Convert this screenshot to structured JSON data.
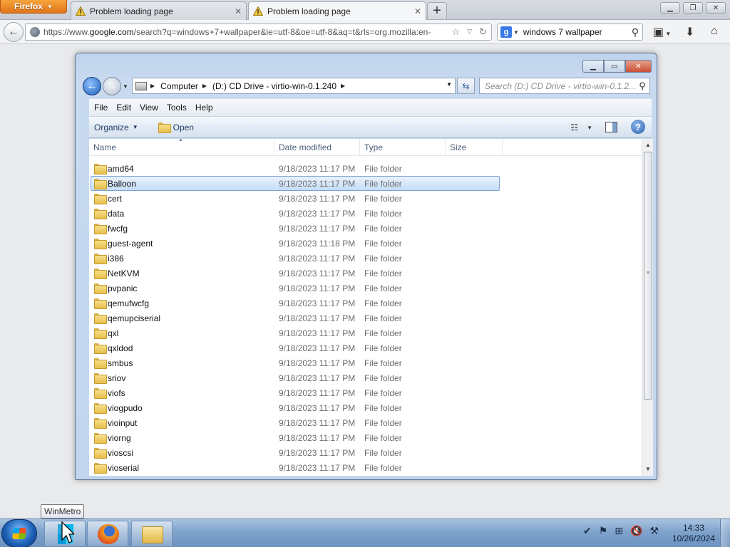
{
  "firefox": {
    "menu_button_label": "Firefox",
    "tabs": [
      {
        "label": "Problem loading page",
        "active": false
      },
      {
        "label": "Problem loading page",
        "active": true
      }
    ],
    "url_prefix": "https://www.",
    "url_domain": "google.com",
    "url_rest": "/search?q=windows+7+wallpaper&ie=utf-8&oe=utf-8&aq=t&rls=org.mozilla:en-",
    "search_engine_icon": "google-icon",
    "search_value": "windows 7 wallpaper"
  },
  "explorer": {
    "breadcrumbs": [
      "Computer",
      "(D:) CD Drive - virtio-win-0.1.240"
    ],
    "search_placeholder": "Search (D:) CD Drive - virtio-win-0.1.2...",
    "menu": [
      "File",
      "Edit",
      "View",
      "Tools",
      "Help"
    ],
    "toolbar": {
      "organize": "Organize",
      "open": "Open"
    },
    "columns": {
      "name": "Name",
      "date": "Date modified",
      "type": "Type",
      "size": "Size"
    },
    "selected_row": 1,
    "rows": [
      {
        "name": "amd64",
        "date": "9/18/2023 11:17 PM",
        "type": "File folder"
      },
      {
        "name": "Balloon",
        "date": "9/18/2023 11:17 PM",
        "type": "File folder"
      },
      {
        "name": "cert",
        "date": "9/18/2023 11:17 PM",
        "type": "File folder"
      },
      {
        "name": "data",
        "date": "9/18/2023 11:17 PM",
        "type": "File folder"
      },
      {
        "name": "fwcfg",
        "date": "9/18/2023 11:17 PM",
        "type": "File folder"
      },
      {
        "name": "guest-agent",
        "date": "9/18/2023 11:18 PM",
        "type": "File folder"
      },
      {
        "name": "i386",
        "date": "9/18/2023 11:17 PM",
        "type": "File folder"
      },
      {
        "name": "NetKVM",
        "date": "9/18/2023 11:17 PM",
        "type": "File folder"
      },
      {
        "name": "pvpanic",
        "date": "9/18/2023 11:17 PM",
        "type": "File folder"
      },
      {
        "name": "qemufwcfg",
        "date": "9/18/2023 11:17 PM",
        "type": "File folder"
      },
      {
        "name": "qemupciserial",
        "date": "9/18/2023 11:17 PM",
        "type": "File folder"
      },
      {
        "name": "qxl",
        "date": "9/18/2023 11:17 PM",
        "type": "File folder"
      },
      {
        "name": "qxldod",
        "date": "9/18/2023 11:17 PM",
        "type": "File folder"
      },
      {
        "name": "smbus",
        "date": "9/18/2023 11:17 PM",
        "type": "File folder"
      },
      {
        "name": "sriov",
        "date": "9/18/2023 11:17 PM",
        "type": "File folder"
      },
      {
        "name": "viofs",
        "date": "9/18/2023 11:17 PM",
        "type": "File folder"
      },
      {
        "name": "viogpudo",
        "date": "9/18/2023 11:17 PM",
        "type": "File folder"
      },
      {
        "name": "vioinput",
        "date": "9/18/2023 11:17 PM",
        "type": "File folder"
      },
      {
        "name": "viorng",
        "date": "9/18/2023 11:17 PM",
        "type": "File folder"
      },
      {
        "name": "vioscsi",
        "date": "9/18/2023 11:17 PM",
        "type": "File folder"
      },
      {
        "name": "vioserial",
        "date": "9/18/2023 11:17 PM",
        "type": "File folder"
      }
    ]
  },
  "taskbar": {
    "tooltip": "WinMetro",
    "items": [
      "start-orb",
      "winmetro-icon",
      "firefox-icon",
      "explorer-icon"
    ],
    "tray_icons": [
      "action-center-icon",
      "flag-icon",
      "network-icon",
      "volume-muted-icon",
      "tool-icon"
    ],
    "time": "14:33",
    "date": "10/26/2024"
  },
  "colors": {
    "firefox_orange": "#e0751a",
    "selection_border": "#7da2ce",
    "taskbar_blue": "#7fa3cb"
  }
}
